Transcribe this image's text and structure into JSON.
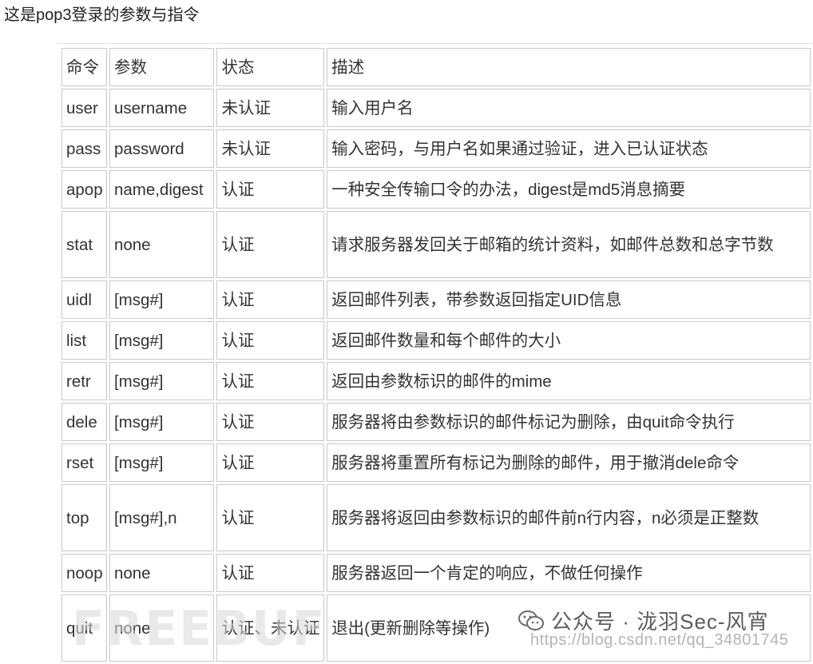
{
  "intro": "这是pop3登录的参数与指令",
  "table": {
    "headers": [
      "命令",
      "参数",
      "状态",
      "描述"
    ],
    "rows": [
      {
        "cmd": "user",
        "param": "username",
        "state": "未认证",
        "desc": "输入用户名",
        "tall": false
      },
      {
        "cmd": "pass",
        "param": "password",
        "state": "未认证",
        "desc": "输入密码，与用户名如果通过验证，进入已认证状态",
        "tall": false
      },
      {
        "cmd": "apop",
        "param": "name,digest",
        "state": "认证",
        "desc": "一种安全传输口令的办法，digest是md5消息摘要",
        "tall": false
      },
      {
        "cmd": "stat",
        "param": "none",
        "state": "认证",
        "desc": "请求服务器发回关于邮箱的统计资料，如邮件总数和总字节数",
        "tall": true
      },
      {
        "cmd": "uidl",
        "param": "[msg#]",
        "state": "认证",
        "desc": "返回邮件列表，带参数返回指定UID信息",
        "tall": false
      },
      {
        "cmd": "list",
        "param": "[msg#]",
        "state": "认证",
        "desc": "返回邮件数量和每个邮件的大小",
        "tall": false
      },
      {
        "cmd": "retr",
        "param": "[msg#]",
        "state": "认证",
        "desc": "返回由参数标识的邮件的mime",
        "tall": false
      },
      {
        "cmd": "dele",
        "param": "[msg#]",
        "state": "认证",
        "desc": "服务器将由参数标识的邮件标记为删除，由quit命令执行",
        "tall": false
      },
      {
        "cmd": "rset",
        "param": "[msg#]",
        "state": "认证",
        "desc": "服务器将重置所有标记为删除的邮件，用于撤消dele命令",
        "tall": false
      },
      {
        "cmd": "top",
        "param": "[msg#],n",
        "state": "认证",
        "desc": "服务器将返回由参数标识的邮件前n行内容，n必须是正整数",
        "tall": true
      },
      {
        "cmd": "noop",
        "param": "none",
        "state": "认证",
        "desc": "服务器返回一个肯定的响应，不做任何操作",
        "tall": false
      },
      {
        "cmd": "quit",
        "param": "none",
        "state": "认证、未认证",
        "desc": "退出(更新删除等操作)",
        "tall": true
      }
    ]
  },
  "watermarks": {
    "wechat": "公众号 · 泷羽Sec-风宵",
    "wechat_icon": "wechat-icon",
    "csdn": "https://blog.csdn.net/qq_34801745",
    "freebuf": "FREEBUF"
  }
}
